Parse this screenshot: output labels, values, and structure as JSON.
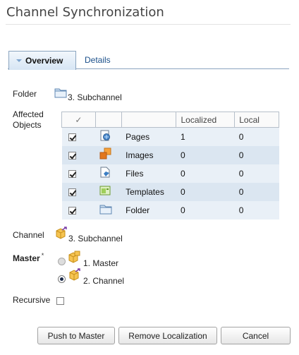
{
  "window": {
    "title": "Channel Synchronization"
  },
  "tabs": [
    {
      "label": "Overview",
      "active": true
    },
    {
      "label": "Details",
      "active": false
    }
  ],
  "folder": {
    "label": "Folder",
    "value": "3. Subchannel"
  },
  "affected": {
    "label_line1": "Affected",
    "label_line2": "Objects",
    "columns": [
      "",
      "",
      "",
      "Localized",
      "Local"
    ],
    "check_header": "✓",
    "rows": [
      {
        "checked": true,
        "icon": "pages-icon",
        "name": "Pages",
        "localized": "1",
        "local": "0"
      },
      {
        "checked": true,
        "icon": "images-icon",
        "name": "Images",
        "localized": "0",
        "local": "0"
      },
      {
        "checked": true,
        "icon": "files-icon",
        "name": "Files",
        "localized": "0",
        "local": "0"
      },
      {
        "checked": true,
        "icon": "templates-icon",
        "name": "Templates",
        "localized": "0",
        "local": "0"
      },
      {
        "checked": true,
        "icon": "folder-icon",
        "name": "Folder",
        "localized": "0",
        "local": "0"
      }
    ]
  },
  "channel": {
    "label": "Channel",
    "value": "3. Subchannel"
  },
  "master": {
    "label": "Master",
    "required_mark": "*",
    "options": [
      {
        "label": "1. Master",
        "selected": false
      },
      {
        "label": "2. Channel",
        "selected": true
      }
    ]
  },
  "recursive": {
    "label": "Recursive",
    "checked": false
  },
  "buttons": {
    "push": "Push to Master",
    "remove": "Remove Localization",
    "cancel": "Cancel"
  },
  "colors": {
    "accent": "#1a4f8a",
    "row_alt": "#dbe6f1",
    "row": "#e9f0f7"
  }
}
